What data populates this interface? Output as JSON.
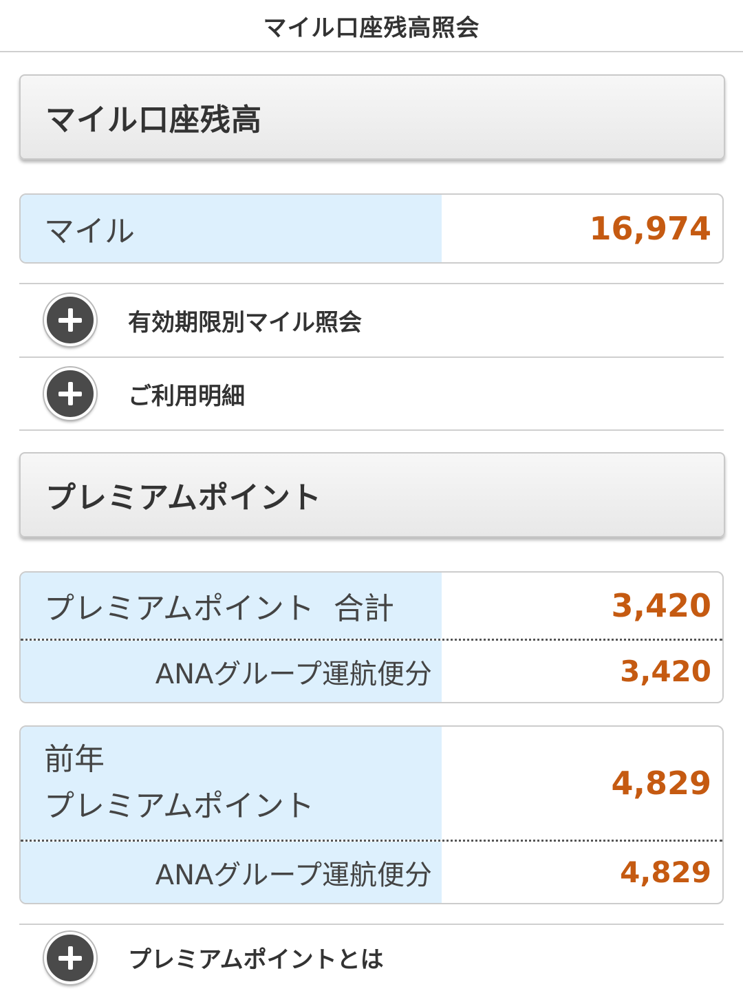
{
  "header": {
    "title": "マイル口座残高照会"
  },
  "mile_section": {
    "title": "マイル口座残高",
    "mile_label": "マイル",
    "mile_value": "16,974",
    "links": [
      {
        "label": "有効期限別マイル照会",
        "icon": "plus-circle-icon"
      },
      {
        "label": "ご利用明細",
        "icon": "plus-circle-icon"
      }
    ]
  },
  "premium_section": {
    "title": "プレミアムポイント",
    "total": {
      "label": "プレミアムポイント  合計",
      "value": "3,420",
      "sub_label": "ANAグループ運航便分",
      "sub_value": "3,420"
    },
    "previous_year": {
      "label_line1": "前年",
      "label_line2": "プレミアムポイント",
      "value": "4,829",
      "sub_label": "ANAグループ運航便分",
      "sub_value": "4,829"
    },
    "links": [
      {
        "label": "プレミアムポイントとは",
        "icon": "plus-circle-icon"
      }
    ]
  },
  "colors": {
    "value_text": "#c55a11",
    "label_bg": "#ddf0fd",
    "header_bg": "#eeeeee",
    "icon_bg": "#4a4a4a"
  }
}
